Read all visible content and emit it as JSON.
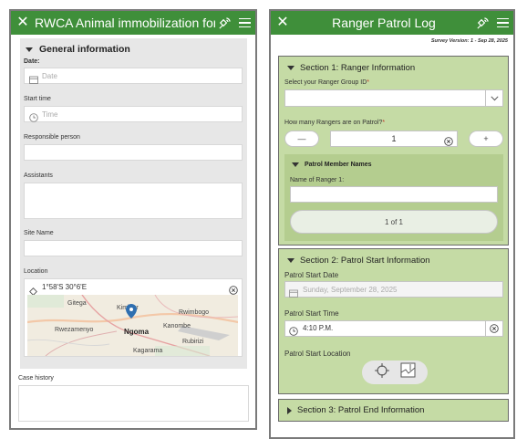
{
  "left": {
    "header": {
      "title": "RWCA Animal immobilization form"
    },
    "group_title": "General information",
    "fields": {
      "date_label": "Date:",
      "date_placeholder": "Date",
      "start_time_label": "Start time",
      "start_time_placeholder": "Time",
      "responsible_label": "Responsible person",
      "assistants_label": "Assistants",
      "site_label": "Site Name",
      "location_label": "Location",
      "location_value": "1°58'S 30°6'E",
      "case_history_label": "Case history"
    },
    "map_labels": {
      "gitega": "Gitega",
      "kimihura": "Kimihur",
      "rwimbogo": "Rwimbogo",
      "rwezamenyo": "Rwezamenyo",
      "ngoma": "Ngoma",
      "kanombe": "Kanombe",
      "rubirizi": "Rubirizi",
      "kagarama": "Kagarama"
    }
  },
  "right": {
    "header": {
      "title": "Ranger Patrol Log"
    },
    "survey_version": "Survey Version: 1 - Sep 28, 2025",
    "section1": {
      "title": "Section 1: Ranger Information",
      "group_id_label": "Select your Ranger Group ID",
      "rangers_label": "How many Rangers are on Patrol?",
      "required_mark": "*",
      "count_value": "1",
      "minus": "—",
      "plus": "+",
      "repeat_title": "Patrol Member Names",
      "ranger_name_label": "Name of Ranger 1:",
      "pager": "1 of 1"
    },
    "section2": {
      "title": "Section 2: Patrol Start Information",
      "date_label": "Patrol Start Date",
      "date_value": "Sunday, September 28, 2025",
      "time_label": "Patrol Start Time",
      "time_value": "4:10 P.M.",
      "location_label": "Patrol Start Location"
    },
    "section3": {
      "title": "Section 3: Patrol End Information"
    }
  },
  "colors": {
    "header_green": "#3f8f3a",
    "section_green": "#c5dba5",
    "required_red": "#c0392b",
    "pin_blue": "#2f6fb0"
  },
  "icons": [
    "close-icon",
    "satellite-icon",
    "menu-icon",
    "calendar-icon",
    "clock-icon",
    "location-icon",
    "clear-icon",
    "chevron-down-icon",
    "gps-icon",
    "map-icon"
  ]
}
